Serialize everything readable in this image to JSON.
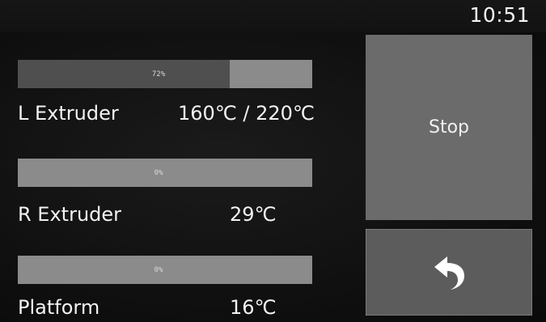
{
  "status_bar": {
    "clock": "10:51"
  },
  "heaters": [
    {
      "label": "L Extruder",
      "temperature": "160℃ / 220℃",
      "progress_text": "72%",
      "progress": 0.72
    },
    {
      "label": "R Extruder",
      "temperature": "29℃",
      "progress_text": "0%",
      "progress": 0
    },
    {
      "label": "Platform",
      "temperature": "16℃",
      "progress_text": "0%",
      "progress": 0
    }
  ],
  "actions": {
    "stop_label": "Stop",
    "back_icon": "back-arrow-icon"
  },
  "colors": {
    "background": "#101010",
    "bar_track": "#8b8b8b",
    "bar_fill": "#4f4f4f",
    "button": "#6b6b6b"
  }
}
